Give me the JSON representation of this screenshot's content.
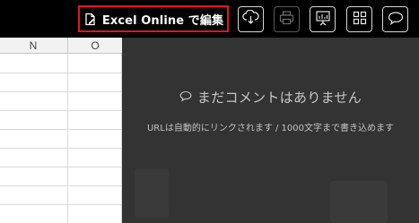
{
  "toolbar": {
    "edit_button_label": "Excel Online で編集",
    "highlight_color": "#e8141a",
    "icons": [
      "document-edit-icon",
      "cloud-download-icon",
      "printer-icon",
      "presentation-icon",
      "grid-view-icon",
      "comment-icon"
    ]
  },
  "sheet": {
    "columns": [
      "N",
      "O"
    ]
  },
  "comments_panel": {
    "empty_title": "まだコメントはありません",
    "empty_hint": "URLは自動的にリンクされます / 1000文字まで書き込めます",
    "icon": "speech-bubble-icon"
  }
}
